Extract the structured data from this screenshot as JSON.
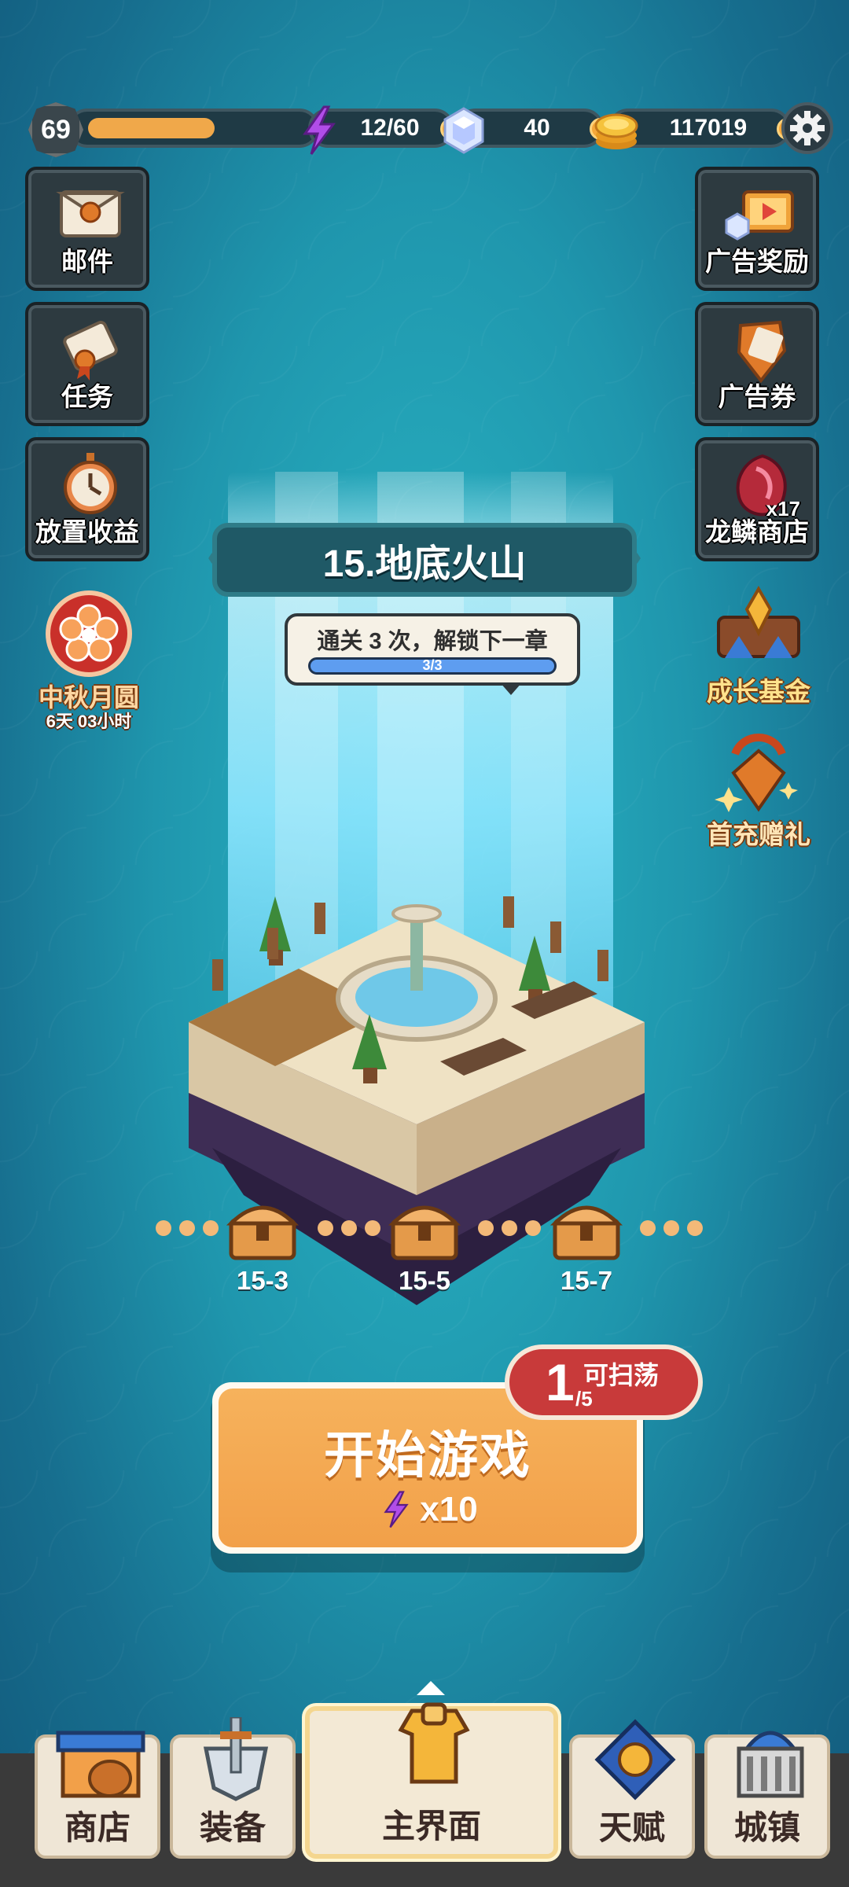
{
  "status": {
    "level": "69",
    "xp_progress": 0.62,
    "energy": "12/60",
    "gems": "40",
    "coins": "117019"
  },
  "left_menu": [
    {
      "label": "邮件",
      "icon": "mail-icon"
    },
    {
      "label": "任务",
      "icon": "scroll-icon"
    },
    {
      "label": "放置收益",
      "icon": "stopwatch-icon"
    }
  ],
  "right_menu": [
    {
      "label": "广告奖励",
      "icon": "tv-ad-icon"
    },
    {
      "label": "广告券",
      "icon": "ticket-shield-icon"
    },
    {
      "label": "龙鳞商店",
      "icon": "dragon-scale-icon",
      "badge": "x17"
    }
  ],
  "event": {
    "title": "中秋月圆",
    "timer": "6天 03小时"
  },
  "right_float": [
    {
      "label": "成长基金",
      "icon": "growth-fund-icon"
    },
    {
      "label": "首充赠礼",
      "icon": "first-recharge-icon"
    }
  ],
  "chapter": {
    "title": "15.地底火山",
    "unlock_text": "通关 3 次，解锁下一章",
    "progress_text": "3/3",
    "progress": 1.0
  },
  "milestones": [
    {
      "label": "15-3"
    },
    {
      "label": "15-5"
    },
    {
      "label": "15-7"
    }
  ],
  "start": {
    "label": "开始游戏",
    "cost": "x10",
    "sweep_count": "1",
    "sweep_total": "/5",
    "sweep_label": "可扫荡"
  },
  "nav": [
    {
      "label": "商店",
      "icon": "shop-icon"
    },
    {
      "label": "装备",
      "icon": "sword-icon"
    },
    {
      "label": "主界面",
      "icon": "armor-icon"
    },
    {
      "label": "天赋",
      "icon": "talent-icon"
    },
    {
      "label": "城镇",
      "icon": "town-icon"
    }
  ],
  "colors": {
    "accent": "#f2a049",
    "bg": "#1f96ad",
    "gold_text": "#ffe28c"
  }
}
